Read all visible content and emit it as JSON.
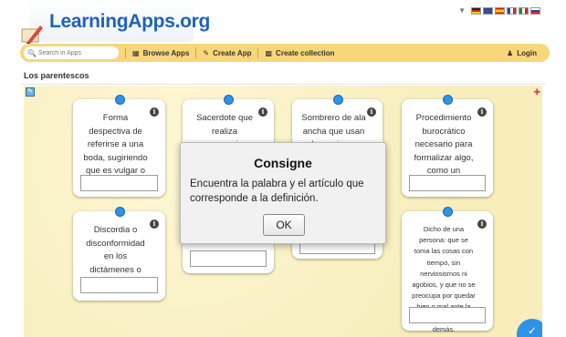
{
  "header": {
    "logo_text": "LearningApps.org",
    "languages": [
      "de",
      "en",
      "es",
      "fr",
      "it",
      "ru"
    ]
  },
  "nav": {
    "search_placeholder": "Search in Apps",
    "browse_label": "Browse Apps",
    "create_label": "Create App",
    "collection_label": "Create collection",
    "login_label": "Login"
  },
  "page": {
    "title": "Los parentescos"
  },
  "cards": [
    {
      "text": "Forma despectiva de referirse a una boda, sugiriendo que es vulgar o exagerada."
    },
    {
      "text": "Sacerdote que realiza ceremonias religiosas, como"
    },
    {
      "text": "Sombrero de ala ancha que usan las mujeres"
    },
    {
      "text": "Procedimiento burocrático necesario para formalizar algo, como un matrimonio."
    },
    {
      "text": "Discordia o disconformidad en los dictámenes o acciones."
    },
    {
      "text": "Dicho de una persona: que se toma las cosas con tiempo, sin nerviosismos ni agobios, y que no se preocupa por quedar bien o mal ante la opinión de los demás."
    }
  ],
  "dialog": {
    "title": "Consigne",
    "body": "Encuentra la palabra y el artículo que corresponde a la definición.",
    "ok_label": "OK"
  }
}
